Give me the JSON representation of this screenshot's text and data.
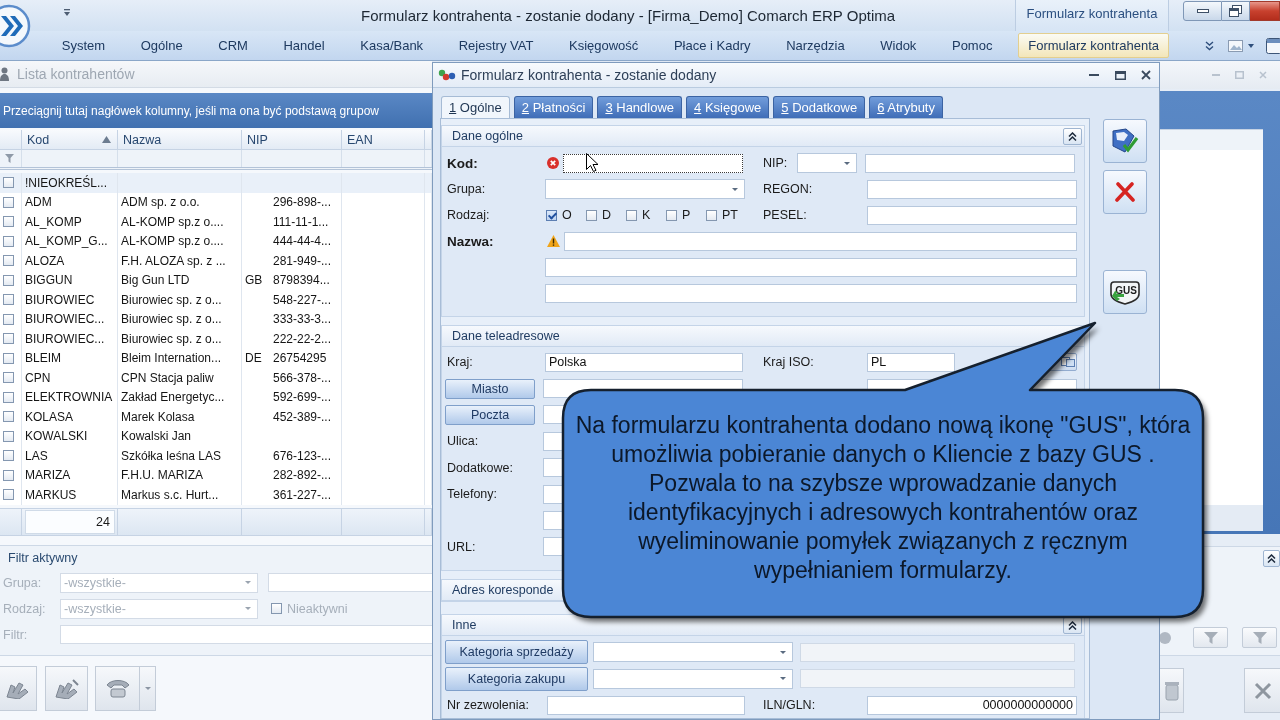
{
  "titlebar": {
    "title": "Formularz kontrahenta - zostanie dodany - [Firma_Demo] Comarch ERP Optima",
    "context_group": "Formularz kontrahenta"
  },
  "menu": [
    {
      "label": "System",
      "selected": false
    },
    {
      "label": "Ogólne",
      "selected": false
    },
    {
      "label": "CRM",
      "selected": false
    },
    {
      "label": "Handel",
      "selected": false
    },
    {
      "label": "Kasa/Bank",
      "selected": false
    },
    {
      "label": "Rejestry VAT",
      "selected": false
    },
    {
      "label": "Księgowość",
      "selected": false
    },
    {
      "label": "Płace i Kadry",
      "selected": false
    },
    {
      "label": "Narzędzia",
      "selected": false
    },
    {
      "label": "Widok",
      "selected": false
    },
    {
      "label": "Pomoc",
      "selected": false
    },
    {
      "label": "Formularz kontrahenta",
      "selected": true
    }
  ],
  "list_window": {
    "title": "Lista kontrahentów",
    "active": false,
    "group_hint": "Przeciągnij tutaj nagłówek kolumny, jeśli ma ona być podstawą grupow",
    "columns": [
      {
        "label": "Kod",
        "sorted": true
      },
      {
        "label": "Nazwa"
      },
      {
        "label": "NIP"
      },
      {
        "label": "EAN"
      }
    ],
    "rows": [
      {
        "kod": "!NIEOKREŚL...",
        "selected": true,
        "checked": false
      },
      {
        "kod": "ADM",
        "nazwa": "ADM sp. z o.o.",
        "nip": "296-898-...",
        "selected": false,
        "checked": false
      },
      {
        "kod": "AL_KOMP",
        "nazwa": "AL-KOMP sp.z o....",
        "nip": "111-11-1...",
        "selected": false,
        "checked": false
      },
      {
        "kod": "AL_KOMP_G...",
        "nazwa": "AL-KOMP sp.z o....",
        "nip": "444-44-4...",
        "selected": false,
        "checked": false
      },
      {
        "kod": "ALOZA",
        "nazwa": "F.H. ALOZA sp. z ...",
        "nip": "281-949-...",
        "selected": false,
        "checked": false
      },
      {
        "kod": "BIGGUN",
        "nazwa": "Big Gun LTD",
        "nip_prefix": "GB",
        "nip": "8798394...",
        "selected": false,
        "checked": false
      },
      {
        "kod": "BIUROWIEC",
        "nazwa": "Biurowiec sp. z o...",
        "nip": "548-227-...",
        "selected": false,
        "checked": false
      },
      {
        "kod": "BIUROWIEC...",
        "nazwa": "Biurowiec sp. z o...",
        "nip": "333-33-3...",
        "selected": false,
        "checked": false
      },
      {
        "kod": "BIUROWIEC...",
        "nazwa": "Biurowiec sp. z o...",
        "nip": "222-22-2...",
        "selected": false,
        "checked": false
      },
      {
        "kod": "BLEIM",
        "nazwa": "Bleim Internation...",
        "nip_prefix": "DE",
        "nip": "26754295",
        "selected": false,
        "checked": false
      },
      {
        "kod": "CPN",
        "nazwa": "CPN Stacja paliw",
        "nip": "566-378-...",
        "selected": false,
        "checked": false
      },
      {
        "kod": "ELEKTROWNIA",
        "nazwa": "Zakład Energetyc...",
        "nip": "592-699-...",
        "selected": false,
        "checked": false
      },
      {
        "kod": "KOLASA",
        "nazwa": "Marek Kolasa",
        "nip": "452-389-...",
        "selected": false,
        "checked": false
      },
      {
        "kod": "KOWALSKI",
        "nazwa": "Kowalski Jan",
        "selected": false,
        "checked": false
      },
      {
        "kod": "LAS",
        "nazwa": "Szkółka leśna LAS",
        "nip": "676-123-...",
        "selected": false,
        "checked": false
      },
      {
        "kod": "MARIZA",
        "nazwa": "F.H.U. MARIZA",
        "nip": "282-892-...",
        "selected": false,
        "checked": false
      },
      {
        "kod": "MARKUS",
        "nazwa": "Markus s.c. Hurt...",
        "nip": "361-227-...",
        "selected": false,
        "checked": false
      }
    ],
    "count": "24",
    "filter": {
      "title": "Filtr aktywny",
      "disabled": true,
      "group_label": "Grupa:",
      "group_value": "-wszystkie-",
      "kind_label": "Rodzaj:",
      "kind_value": "-wszystkie-",
      "inactive": {
        "label": "Nieaktywni",
        "checked": false
      },
      "filter_label": "Filtr:"
    }
  },
  "form": {
    "title": "Formularz kontrahenta - zostanie dodany",
    "active": true,
    "tabs": [
      {
        "key": "1",
        "label": "Ogólne",
        "selected": true
      },
      {
        "key": "2",
        "label": "Płatności",
        "selected": false
      },
      {
        "key": "3",
        "label": "Handlowe",
        "selected": false
      },
      {
        "key": "4",
        "label": "Księgowe",
        "selected": false
      },
      {
        "key": "5",
        "label": "Dodatkowe",
        "selected": false
      },
      {
        "key": "6",
        "label": "Atrybuty",
        "selected": false
      }
    ],
    "general": {
      "title": "Dane ogólne",
      "expanded": true,
      "kod": {
        "label": "Kod:",
        "required": true,
        "error": true
      },
      "nip_label": "NIP:",
      "grupa_label": "Grupa:",
      "regon_label": "REGON:",
      "rodzaj_label": "Rodzaj:",
      "rodzaj": [
        {
          "label": "O",
          "checked": true
        },
        {
          "label": "D",
          "checked": false
        },
        {
          "label": "K",
          "checked": false
        },
        {
          "label": "P",
          "checked": false
        },
        {
          "label": "PT",
          "checked": false
        }
      ],
      "pesel_label": "PESEL:",
      "nazwa": {
        "label": "Nazwa:",
        "required": true,
        "warning": true
      }
    },
    "contact": {
      "title": "Dane teleadresowe",
      "kraj_label": "Kraj:",
      "kraj": "Polska",
      "iso_label": "Kraj ISO:",
      "iso": "PL",
      "city_button": "Miasto",
      "post_button": "Poczta",
      "ulica_label": "Ulica:",
      "dodatkowe_label": "Dodatkowe:",
      "telefony_label": "Telefony:",
      "url_label": "URL:"
    },
    "correspondence": {
      "title": "Adres koresponde"
    },
    "other": {
      "title": "Inne",
      "expanded": true,
      "sales_button": "Kategoria sprzedaży",
      "purchase_button": "Kategoria zakupu",
      "permit_label": "Nr zezwolenia:",
      "gln_label": "ILN/GLN:",
      "gln": "0000000000000"
    },
    "actions": [
      {
        "kind": "save"
      },
      {
        "kind": "cancel"
      },
      {
        "kind": "gus",
        "label": "GUS"
      }
    ]
  },
  "callout": {
    "text": "Na formularzu kontrahenta dodano nową ikonę \"GUS\", która umożliwia pobieranie danych o Kliencie z bazy GUS . Pozwala to na szybsze wprowadzanie danych identyfikacyjnych i adresowych kontrahentów oraz wyeliminowanie pomyłek związanych z ręcznym wypełnianiem formularzy."
  }
}
